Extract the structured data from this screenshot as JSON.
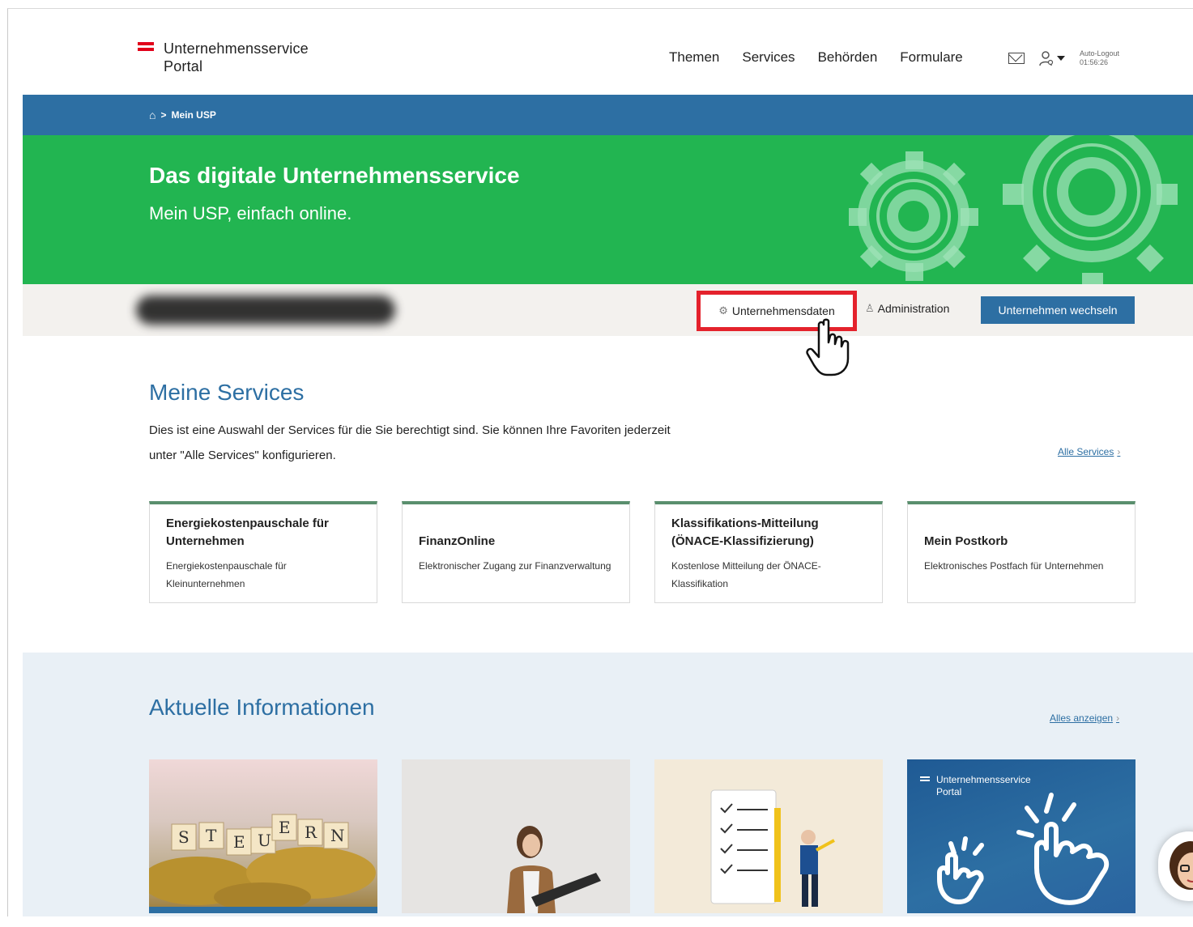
{
  "header": {
    "logo_line1": "Unternehmensservice",
    "logo_line2": "Portal",
    "nav": [
      "Themen",
      "Services",
      "Behörden",
      "Formulare"
    ],
    "logout_label": "Auto-Logout",
    "logout_time": "01:56:26",
    "icons": {
      "mail": "mail-icon",
      "user": "user-icon"
    }
  },
  "breadcrumb": {
    "home_icon": "home-icon",
    "separator": ">",
    "current": "Mein USP"
  },
  "hero": {
    "title": "Das digitale Unternehmensservice",
    "subtitle": "Mein USP, einfach online."
  },
  "company_strip": {
    "unternehmensdaten_label": "Unternehmensdaten",
    "administration_label": "Administration",
    "switch_label": "Unternehmen wechseln"
  },
  "services": {
    "title": "Meine Services",
    "description": "Dies ist eine Auswahl der Services für die Sie berechtigt sind. Sie können Ihre Favoriten jederzeit unter \"Alle Services\" konfigurieren.",
    "all_link": "Alle Services",
    "cards": [
      {
        "title": "Energiekostenpauschale für Unternehmen",
        "desc": "Energiekostenpauschale für Kleinunternehmen"
      },
      {
        "title": "FinanzOnline",
        "desc": "Elektronischer Zugang zur Finanzverwaltung"
      },
      {
        "title": "Klassifikations-Mitteilung (ÖNACE-Klassifizierung)",
        "desc": "Kostenlose Mitteilung der ÖNACE-Klassifikation"
      },
      {
        "title": "Mein Postkorb",
        "desc": "Elektronisches Postfach für Unternehmen"
      }
    ]
  },
  "news": {
    "title": "Aktuelle Informationen",
    "all_link": "Alles anzeigen",
    "mini_logo_line1": "Unternehmensservice",
    "mini_logo_line2": "Portal"
  },
  "colors": {
    "brand_blue": "#2d6fa3",
    "hero_green": "#22b551",
    "highlight_red": "#e4222c",
    "card_accent": "#5a8f6e"
  }
}
